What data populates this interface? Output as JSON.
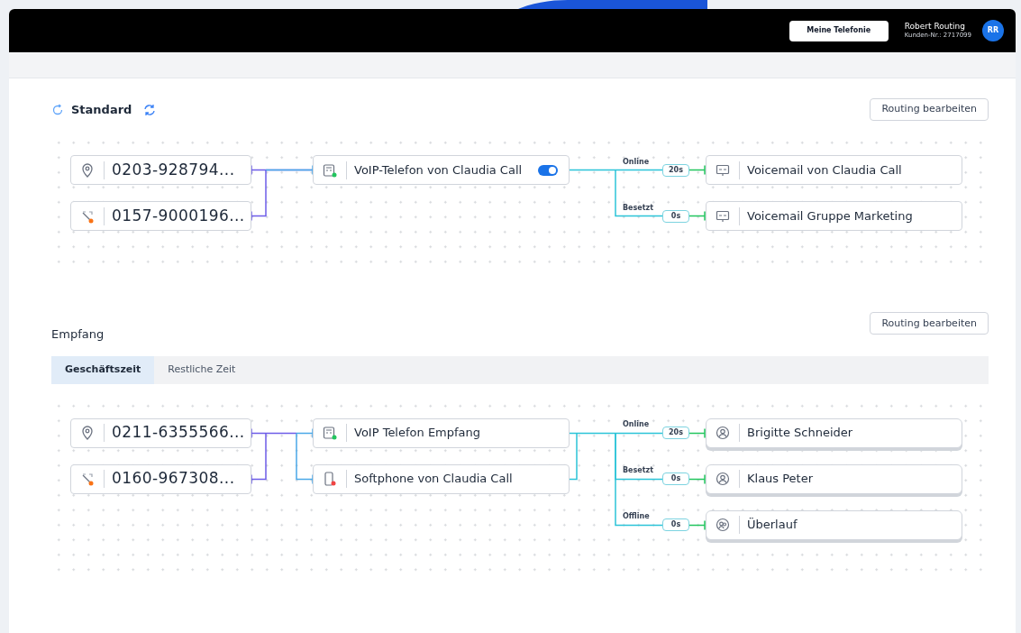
{
  "header": {
    "button": "Meine Telefonie",
    "user": {
      "name": "Robert Routing",
      "customer_number": "Kunden-Nr.: 2717099",
      "initials": "RR"
    }
  },
  "sections": [
    {
      "kind": "standard",
      "title": "Standard",
      "edit_button": "Routing bearbeiten",
      "sources": [
        {
          "kind": "landline",
          "number": "0203-928794..."
        },
        {
          "kind": "mobile",
          "number": "0157-9000196..."
        }
      ],
      "devices": [
        {
          "kind": "voip",
          "name": "VoIP-Telefon von Claudia Call",
          "toggle": {
            "on": true
          }
        }
      ],
      "routes": [
        {
          "condition": "Online",
          "delay": "20s",
          "target": {
            "kind": "voicemail",
            "name": "Voicemail von Claudia Call"
          }
        },
        {
          "condition": "Besetzt",
          "delay": "0s",
          "target": {
            "kind": "voicemail",
            "name": "Voicemail Gruppe Marketing"
          }
        }
      ]
    },
    {
      "kind": "group",
      "title": "Empfang",
      "edit_button": "Routing bearbeiten",
      "tabs": [
        {
          "label": "Geschäftszeit",
          "selected": true
        },
        {
          "label": "Restliche Zeit",
          "selected": false
        }
      ],
      "sources": [
        {
          "kind": "landline",
          "number": "0211-6355566..."
        },
        {
          "kind": "mobile",
          "number": "0160-967308..."
        }
      ],
      "devices": [
        {
          "kind": "voip",
          "name": "VoIP Telefon Empfang"
        },
        {
          "kind": "softphone",
          "name": "Softphone von Claudia Call"
        }
      ],
      "routes": [
        {
          "condition": "Online",
          "delay": "20s",
          "target": {
            "kind": "person",
            "name": "Brigitte Schneider"
          }
        },
        {
          "condition": "Besetzt",
          "delay": "0s",
          "target": {
            "kind": "person",
            "name": "Klaus Peter"
          }
        },
        {
          "condition": "Offline",
          "delay": "0s",
          "target": {
            "kind": "group",
            "name": "Überlauf"
          }
        }
      ]
    }
  ]
}
